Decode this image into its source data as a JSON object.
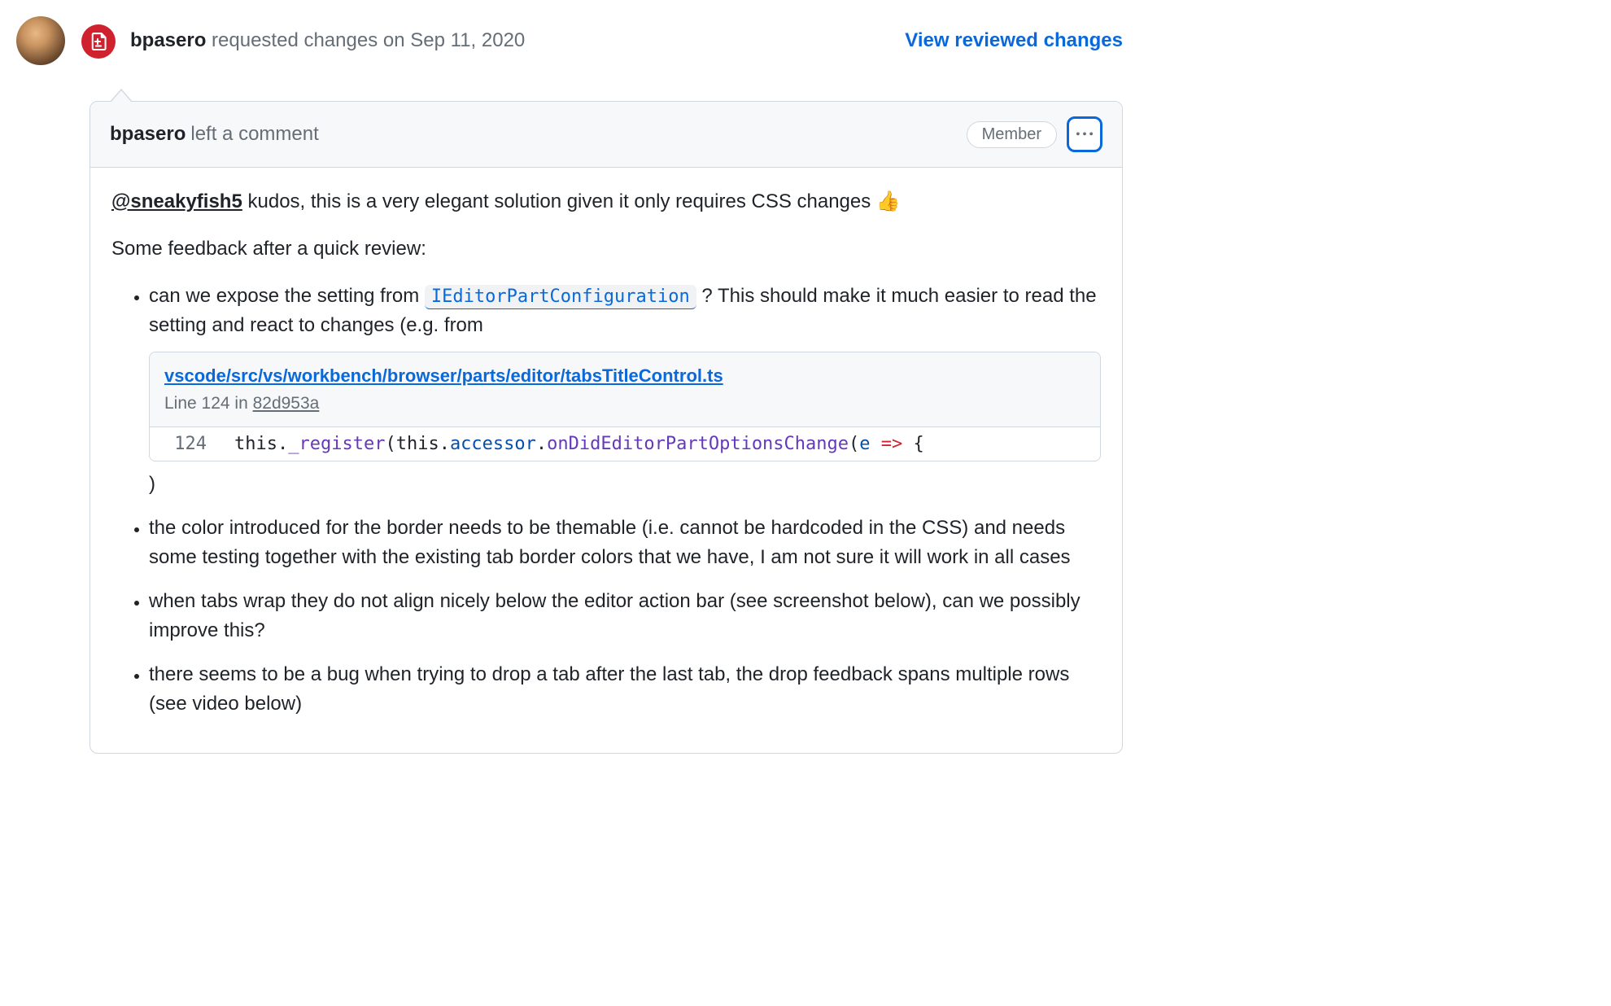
{
  "review": {
    "author": "bpasero",
    "action": "requested changes",
    "time_prefix": "on",
    "time": "Sep 11, 2020",
    "view_link": "View reviewed changes"
  },
  "comment": {
    "author": "bpasero",
    "header_suffix": "left a comment",
    "badge": "Member",
    "mention": "@sneakyfish5",
    "intro_rest": " kudos, this is a very elegant solution given it only requires CSS changes ",
    "emoji": "👍",
    "feedback_heading": "Some feedback after a quick review:",
    "bullet1_pre": "can we expose the setting from ",
    "bullet1_code": "IEditorPartConfiguration",
    "bullet1_post": " ? This should make it much easier to read the setting and react to changes (e.g. from",
    "bullet1_close": ")",
    "bullet2": "the color introduced for the border needs to be themable (i.e. cannot be hardcoded in the CSS) and needs some testing together with the existing tab border colors that we have, I am not sure it will work in all cases",
    "bullet3": "when tabs wrap they do not align nicely below the editor action bar (see screenshot below), can we possibly improve this?",
    "bullet4": "there seems to be a bug when trying to drop a tab after the last tab, the drop feedback spans multiple rows (see video below)"
  },
  "snippet": {
    "path": "vscode/src/vs/workbench/browser/parts/editor/tabsTitleControl.ts",
    "line_label": "Line 124 in ",
    "sha": "82d953a",
    "lineno": "124",
    "tokens": {
      "t1": "this",
      "dot1": ".",
      "t2": "_register",
      "open1": "(",
      "t3": "this",
      "dot2": ".",
      "t4": "accessor",
      "dot3": ".",
      "t5": "onDidEditorPartOptionsChange",
      "open2": "(",
      "t6": "e",
      "arrow": " => ",
      "brace": "{"
    }
  }
}
